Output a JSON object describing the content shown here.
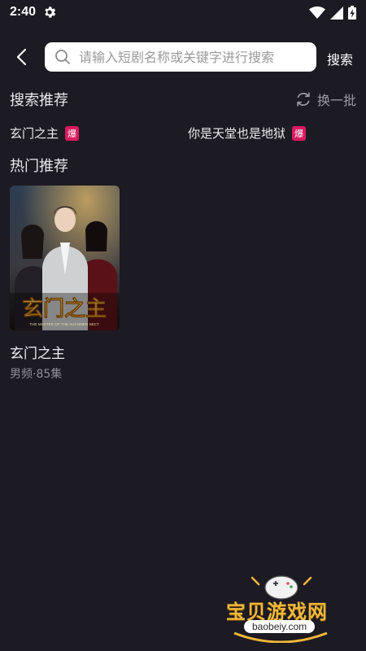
{
  "status_bar": {
    "time": "2:40",
    "icons": [
      "settings-gear-icon",
      "wifi-icon",
      "signal-icon",
      "battery-icon"
    ]
  },
  "search": {
    "placeholder": "请输入短剧名称或关键字进行搜索",
    "value": "",
    "button_label": "搜索"
  },
  "recommend": {
    "title": "搜索推荐",
    "refresh_label": "换一批",
    "items": [
      {
        "label": "玄门之主",
        "badge": "爆"
      },
      {
        "label": "你是天堂也是地狱",
        "badge": "爆"
      }
    ]
  },
  "hot": {
    "title": "热门推荐",
    "cards": [
      {
        "title": "玄门之主",
        "subtitle": "男频·85集",
        "poster_title": "玄门之主",
        "poster_english": "THE MASTER OF THE XUANMEN SECT"
      }
    ]
  },
  "watermark": {
    "text": "宝贝游戏网",
    "site": "baobeiy.com"
  },
  "colors": {
    "background": "#1c1a22",
    "badge": "#d81b60",
    "watermark": "#f0b83a"
  }
}
